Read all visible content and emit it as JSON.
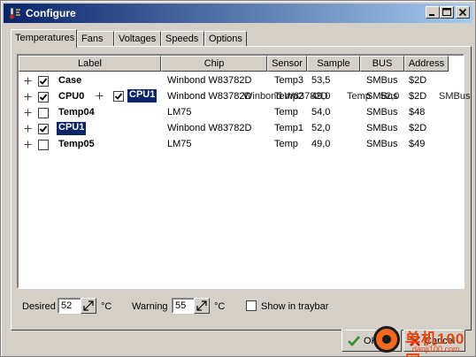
{
  "window": {
    "title": "Configure"
  },
  "tabs": [
    {
      "label": "Temperatures",
      "active": true
    },
    {
      "label": "Fans",
      "active": false
    },
    {
      "label": "Voltages",
      "active": false
    },
    {
      "label": "Speeds",
      "active": false
    },
    {
      "label": "Options",
      "active": false
    }
  ],
  "table": {
    "headers": [
      "Label",
      "Chip",
      "Sensor",
      "Sample",
      "BUS",
      "Address"
    ],
    "rows": [
      {
        "label": "Case",
        "checked": true,
        "chip": "Winbond W83782D",
        "sensor": "Temp3",
        "sample": "53,5",
        "bus": "SMBus",
        "address": "$2D"
      },
      {
        "label": "CPU0",
        "checked": true,
        "chip": "Winbond W83782D",
        "sensor": "Temp2",
        "sample": "49,0",
        "bus": "SMBus",
        "address": "$2D"
      },
      {
        "label": "Temp04",
        "checked": false,
        "chip": "LM75",
        "sensor": "Temp",
        "sample": "54,0",
        "bus": "SMBus",
        "address": "$48"
      },
      {
        "label": "CPU1",
        "checked": true,
        "chip": "Winbond W83782D",
        "sensor": "Temp1",
        "sample": "52,0",
        "bus": "SMBus",
        "address": "$2D",
        "selected": true
      },
      {
        "label": "Temp05",
        "checked": false,
        "chip": "LM75",
        "sensor": "Temp",
        "sample": "49,0",
        "bus": "SMBus",
        "address": "$49"
      }
    ],
    "drag_ghost": {
      "label": "CPU1",
      "chip": "Winbond W83782D",
      "sensor": "Temp",
      "sample": "52,0",
      "bus": "SMBus"
    }
  },
  "bottom": {
    "desired_label": "Desired",
    "desired_value": "52",
    "desired_unit": "°C",
    "warning_label": "Warning",
    "warning_value": "55",
    "warning_unit": "°C",
    "traybar_label": "Show in traybar",
    "traybar_checked": false
  },
  "buttons": {
    "ok_label": "OK",
    "cancel_label": "Cancel"
  },
  "watermark": {
    "line1": "单机100网",
    "line2": "danji100.com"
  },
  "colors": {
    "title_start": "#0a246a",
    "title_end": "#a6caf0",
    "selection": "#0a246a",
    "check_green": "#2f8f2f",
    "cancel_red": "#cc1111",
    "watermark": "#e2470d"
  }
}
